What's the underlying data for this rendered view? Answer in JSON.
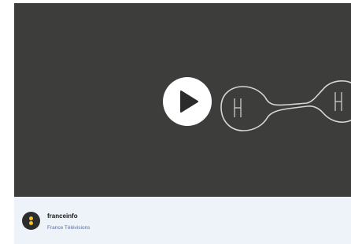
{
  "video": {
    "play_icon": "play-icon",
    "thumbnail_content": "H–H molecule drawing",
    "atom_left_label": "H",
    "atom_right_label": "H"
  },
  "channel": {
    "name": "franceinfo",
    "publisher": "France Télévisions",
    "logo_icon": "franceinfo-logo-icon"
  },
  "colors": {
    "video_background": "#3d3e3c",
    "footer_background": "#eef3f9",
    "logo_background": "#2c2c2a",
    "logo_dots": "#f6c21c",
    "publisher_text": "#5b6f9a"
  }
}
